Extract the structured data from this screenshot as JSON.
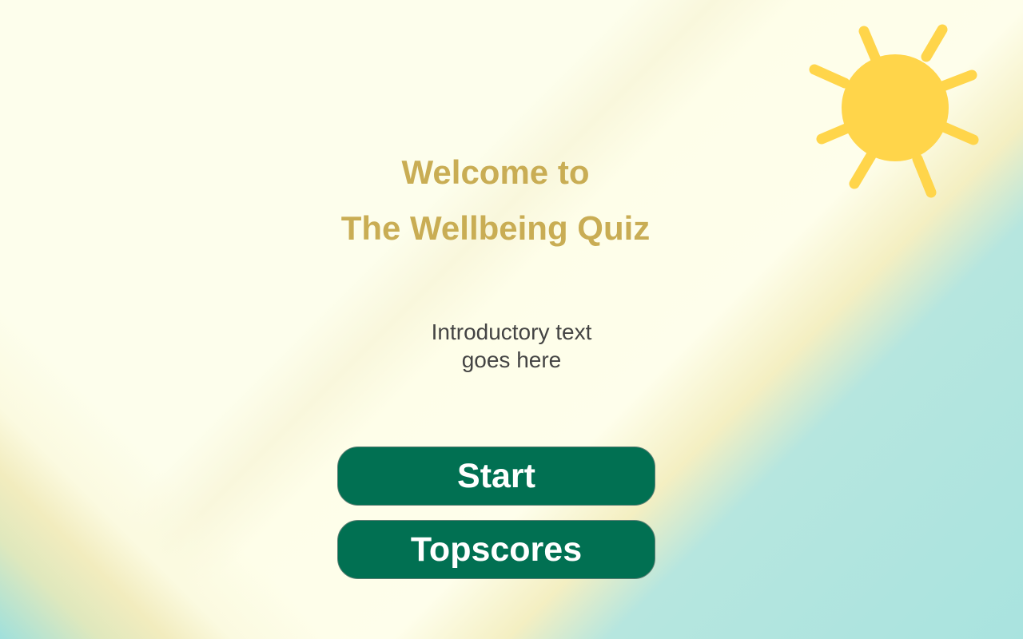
{
  "welcome": {
    "line1": "Welcome to",
    "line2": "The Wellbeing Quiz"
  },
  "intro": {
    "line1": "Introductory text",
    "line2": "goes here"
  },
  "buttons": {
    "start_label": "Start",
    "topscores_label": "Topscores"
  },
  "decoration": {
    "icon": "sun-icon",
    "sun_color": "#ffd54a"
  },
  "colors": {
    "title": "#c9ad54",
    "button_bg": "#017052",
    "intro_text": "#444444"
  }
}
